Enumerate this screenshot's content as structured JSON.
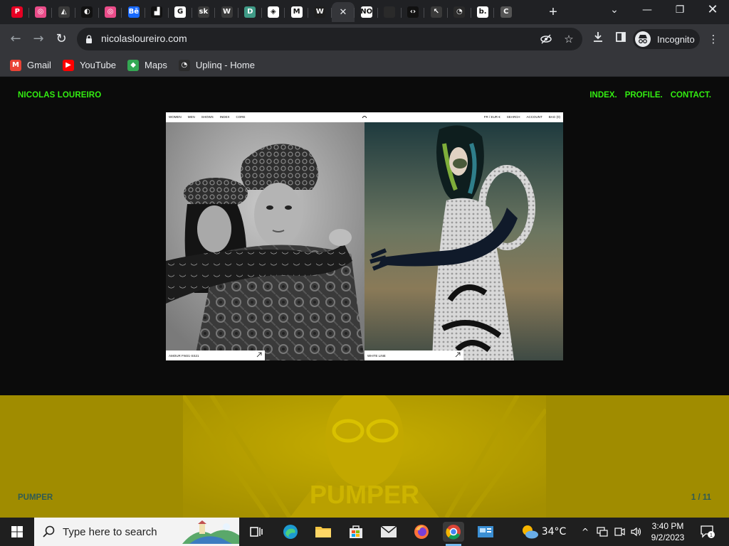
{
  "browser": {
    "tabs": [
      {
        "name": "Pinterest",
        "icon": "pinterest-icon",
        "color": "#e60023",
        "glyph": "P"
      },
      {
        "name": "Dribbble",
        "icon": "dribbble-icon",
        "color": "#ea4c89",
        "glyph": "◎"
      },
      {
        "name": "Prism",
        "icon": "prism-icon",
        "color": "#3a3a3a",
        "glyph": "◭"
      },
      {
        "name": "Moon",
        "icon": "moon-icon",
        "color": "#111111",
        "glyph": "◐"
      },
      {
        "name": "Dribbble 2",
        "icon": "dribbble-icon",
        "color": "#ea4c89",
        "glyph": "◎"
      },
      {
        "name": "Behance",
        "icon": "behance-icon",
        "color": "#1769ff",
        "glyph": "Bē"
      },
      {
        "name": "Bookmark app",
        "icon": "bookmark-app-icon",
        "color": "#111111",
        "glyph": "▟"
      },
      {
        "name": "Google",
        "icon": "google-icon",
        "color": "#ffffff",
        "glyph": "G"
      },
      {
        "name": "Site sk",
        "icon": "sk-icon",
        "color": "#3a3a3a",
        "glyph": "sk"
      },
      {
        "name": "Webflow W",
        "icon": "w-icon",
        "color": "#3a3a3a",
        "glyph": "W"
      },
      {
        "name": "Site D",
        "icon": "d-icon",
        "color": "#3f9a86",
        "glyph": "D"
      },
      {
        "name": "Codepen",
        "icon": "codepen-icon",
        "color": "#ffffff",
        "glyph": "◈"
      },
      {
        "name": "Gmail",
        "icon": "gmail-icon",
        "color": "#ffffff",
        "glyph": "M"
      },
      {
        "name": "Webflow",
        "icon": "webflow-icon",
        "color": "#1f1f1f",
        "glyph": "W"
      },
      {
        "name": "Nicolas Loureiro",
        "icon": "figure-icon",
        "color": "#c8e03c",
        "glyph": "♟",
        "active": true
      },
      {
        "name": "NO",
        "icon": "no-icon",
        "color": "#ffffff",
        "glyph": "NO"
      },
      {
        "name": "Blank",
        "icon": "blank-tab-icon",
        "color": "#2a2a2a",
        "glyph": ""
      },
      {
        "name": "Code",
        "icon": "code-icon",
        "color": "#111111",
        "glyph": "‹›"
      },
      {
        "name": "Cursor",
        "icon": "cursor-icon",
        "color": "#3a3a3a",
        "glyph": "↖"
      },
      {
        "name": "Tune",
        "icon": "tune-icon",
        "color": "#2a2a2a",
        "glyph": "◔"
      },
      {
        "name": "b.",
        "icon": "b-icon",
        "color": "#ffffff",
        "glyph": "b."
      },
      {
        "name": "C",
        "icon": "c-icon",
        "color": "#555555",
        "glyph": "C"
      }
    ],
    "url": "nicolasloureiro.com",
    "incognito_label": "Incognito",
    "bookmarks": [
      {
        "label": "Gmail",
        "icon": "gmail-icon"
      },
      {
        "label": "YouTube",
        "icon": "youtube-icon"
      },
      {
        "label": "Maps",
        "icon": "maps-icon"
      },
      {
        "label": "Uplinq - Home",
        "icon": "uplinq-icon"
      }
    ]
  },
  "site": {
    "brand": "NICOLAS LOUREIRO",
    "nav": [
      "INDEX.",
      "PROFILE.",
      "CONTACT."
    ],
    "accent": "#33ee11",
    "preview": {
      "nav_left": [
        "WOMEN",
        "MEN",
        "SHOWS",
        "INDEX",
        "CORE"
      ],
      "nav_right": [
        "FR / EUR €",
        "SEARCH",
        "ACCOUNT",
        "BAG (0)"
      ],
      "caption_left": "AMOUR FW21-SS21",
      "caption_right": "WHITE LINE"
    },
    "hero": {
      "title": "PUMPER",
      "label": "PUMPER",
      "pager": "1 / 11",
      "background": "#a08c00"
    }
  },
  "taskbar": {
    "search_placeholder": "Type here to search",
    "weather": "34°C",
    "time": "3:40 PM",
    "date": "9/2/2023",
    "notification_count": "1"
  }
}
